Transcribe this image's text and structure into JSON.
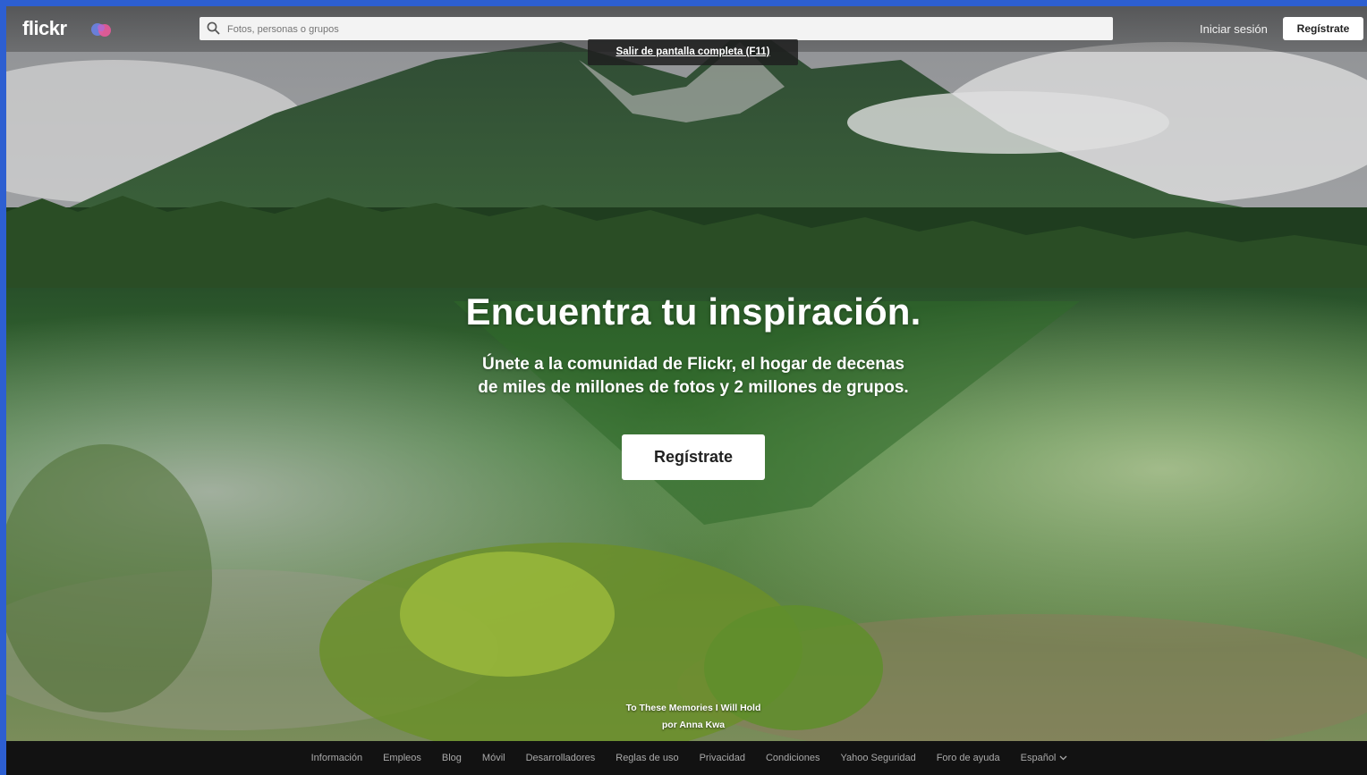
{
  "header": {
    "logo": "flickr",
    "promo_icon": "flickr-pro-bubbles-icon",
    "search_placeholder": "Fotos, personas o grupos",
    "signin_label": "Iniciar sesión",
    "signup_label": "Regístrate"
  },
  "overlay": {
    "exit_fullscreen": "Salir de pantalla completa (F11)"
  },
  "hero": {
    "title": "Encuentra tu inspiración.",
    "subtitle_line1": "Únete a la comunidad de Flickr, el hogar de decenas",
    "subtitle_line2": "de miles de millones de fotos y 2 millones de grupos.",
    "cta_label": "Regístrate"
  },
  "photo_credit": {
    "title": "To These Memories I Will Hold",
    "author": "por Anna Kwa"
  },
  "footer": {
    "links": [
      "Información",
      "Empleos",
      "Blog",
      "Móvil",
      "Desarrolladores",
      "Reglas de uso",
      "Privacidad",
      "Condiciones",
      "Yahoo Seguridad",
      "Foro de ayuda"
    ],
    "language": "Español"
  },
  "colors": {
    "window_border": "#2d5fd1",
    "footer_bg": "#121212",
    "footer_text": "#a9a9a9"
  }
}
